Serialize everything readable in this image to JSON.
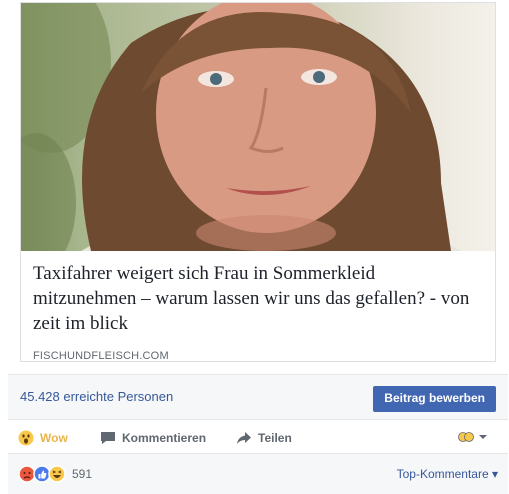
{
  "article": {
    "headline": "Taxifahrer weigert sich Frau in Sommerkleid mitzunehmen – warum lassen wir uns das gefallen? - von zeit im blick",
    "source": "FISCHUNDFLEISCH.COM"
  },
  "reach": {
    "text": "45.428 erreichte Personen",
    "boost_label": "Beitrag bewerben"
  },
  "actions": {
    "wow_label": "Wow",
    "comment_label": "Kommentieren",
    "share_label": "Teilen"
  },
  "reactions": {
    "count": "591",
    "top_comments_label": "Top-Kommentare ▾"
  },
  "colors": {
    "link_blue": "#365899",
    "button_blue": "#4267b2",
    "wow_yellow": "#e9b44c"
  }
}
